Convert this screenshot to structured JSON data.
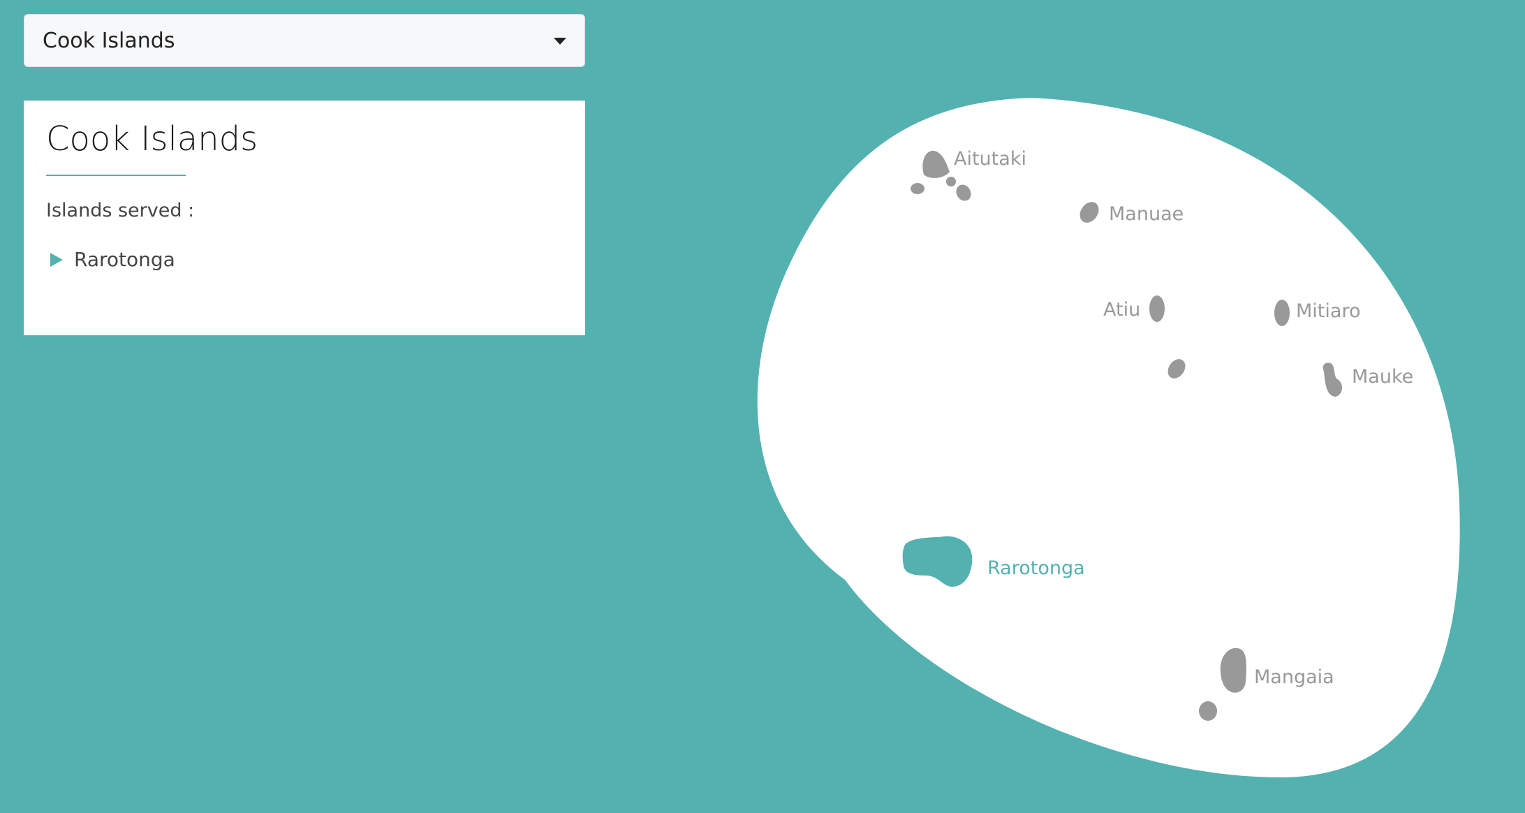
{
  "selector": {
    "selected_value": "Cook Islands"
  },
  "panel": {
    "title": "Cook Islands",
    "served_label": "Islands served :",
    "islands_served": [
      "Rarotonga"
    ]
  },
  "map": {
    "selected_island": "Rarotonga",
    "highlight_color": "#53b1b0",
    "island_color": "#999999",
    "background_color": "#53b1b0",
    "islands": [
      {
        "name": "Aitutaki",
        "selected": false
      },
      {
        "name": "Manuae",
        "selected": false
      },
      {
        "name": "Atiu",
        "selected": false
      },
      {
        "name": "Mitiaro",
        "selected": false
      },
      {
        "name": "Mauke",
        "selected": false
      },
      {
        "name": "Rarotonga",
        "selected": true
      },
      {
        "name": "Mangaia",
        "selected": false
      }
    ]
  }
}
